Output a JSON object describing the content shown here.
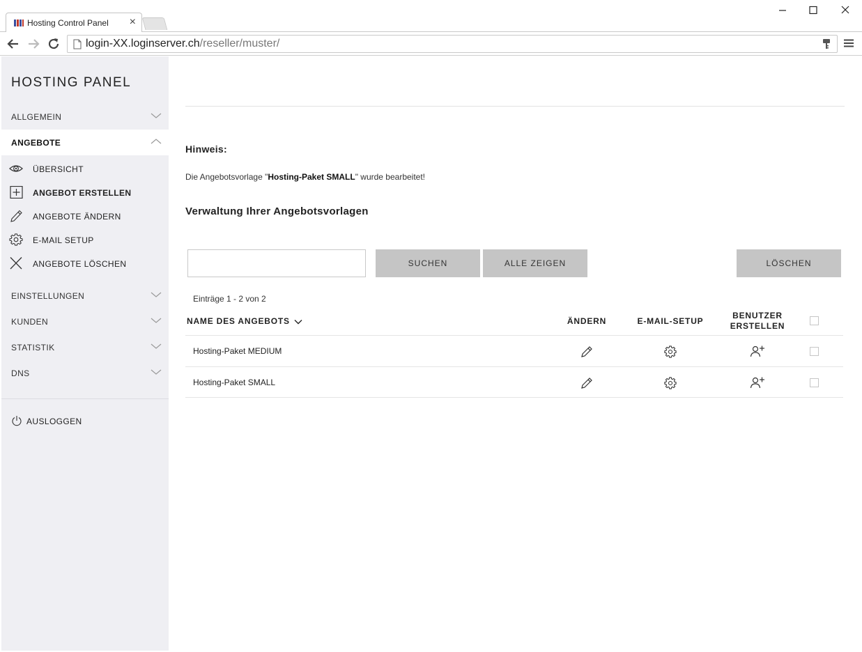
{
  "browser": {
    "tab_title": "Hosting Control Panel",
    "tab_close": "×",
    "url_host": "login-XX.loginserver.ch",
    "url_path": "/reseller/muster/"
  },
  "sidebar": {
    "brand": "HOSTING PANEL",
    "sections": [
      {
        "label": "ALLGEMEIN",
        "expanded": false
      },
      {
        "label": "ANGEBOTE",
        "expanded": true
      },
      {
        "label": "EINSTELLUNGEN",
        "expanded": false
      },
      {
        "label": "KUNDEN",
        "expanded": false
      },
      {
        "label": "STATISTIK",
        "expanded": false
      },
      {
        "label": "DNS",
        "expanded": false
      }
    ],
    "sub_items": [
      {
        "label": "ÜBERSICHT",
        "icon": "eye-icon",
        "active": false
      },
      {
        "label": "ANGEBOT ERSTELLEN",
        "icon": "plus-box-icon",
        "active": true
      },
      {
        "label": "ANGEBOTE ÄNDERN",
        "icon": "pencil-icon",
        "active": false
      },
      {
        "label": "E-MAIL SETUP",
        "icon": "gear-icon",
        "active": false
      },
      {
        "label": "ANGEBOTE LÖSCHEN",
        "icon": "x-icon",
        "active": false
      }
    ],
    "logout": "AUSLOGGEN"
  },
  "notice": {
    "title": "Hinweis:",
    "text_before": "Die Angebotsvorlage \"",
    "text_bold": "Hosting-Paket SMALL",
    "text_after": "\" wurde bearbeitet!"
  },
  "section_title": "Verwaltung Ihrer Angebotsvorlagen",
  "search": {
    "value": "",
    "placeholder": ""
  },
  "buttons": {
    "search": "SUCHEN",
    "show_all": "ALLE ZEIGEN",
    "delete": "LÖSCHEN"
  },
  "entries": "Einträge 1 - 2 von 2",
  "table": {
    "columns": {
      "name": "NAME DES ANGEBOTS",
      "edit": "ÄNDERN",
      "mail": "E-MAIL-SETUP",
      "user_line1": "BENUTZER",
      "user_line2": "ERSTELLEN"
    },
    "rows": [
      {
        "name": "Hosting-Paket MEDIUM",
        "checked": false
      },
      {
        "name": "Hosting-Paket SMALL",
        "checked": false
      }
    ]
  },
  "colors": {
    "sidebar_bg": "#efeff3",
    "button_bg": "#c5c5c5",
    "text": "#222222"
  }
}
